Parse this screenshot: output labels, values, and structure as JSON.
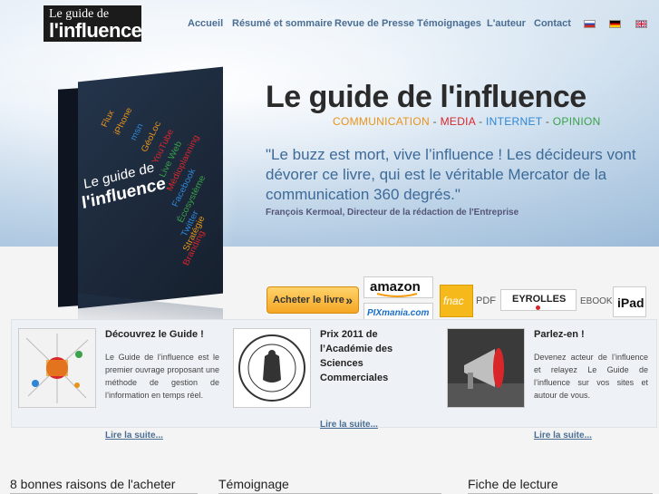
{
  "logo": {
    "line1": "Le guide de",
    "line2": "l'influence"
  },
  "nav": {
    "items": [
      "Accueil",
      "Résumé et sommaire",
      "Revue de Presse",
      "Témoignages",
      "L'auteur",
      "Contact"
    ]
  },
  "flags": [
    "ru",
    "de",
    "en"
  ],
  "book": {
    "title1": "Le guide de",
    "title2": "l'influence",
    "words": [
      "Flux",
      "iPhone",
      "msn",
      "GéoLoc",
      "YouTube",
      "Live Web",
      "Médioplanning",
      "Facebook",
      "Écosystème",
      "Twitter",
      "Stratégie",
      "Branding",
      "Tactique",
      "Open Source",
      "Sondage",
      "Rôles",
      "Leaders"
    ]
  },
  "hero": {
    "title": "Le guide de l'influence",
    "tagline": [
      {
        "text": "COMMUNICATION",
        "color": "#e8941a"
      },
      {
        "text": " - ",
        "color": "#555555"
      },
      {
        "text": "MEDIA",
        "color": "#d9262b"
      },
      {
        "text": " - ",
        "color": "#555555"
      },
      {
        "text": "INTERNET",
        "color": "#2e86d6"
      },
      {
        "text": " - ",
        "color": "#555555"
      },
      {
        "text": "OPINION",
        "color": "#3aa24a"
      }
    ],
    "quote": "\"Le buzz est mort, vive l’influence ! Les décideurs vont dévorer ce livre, qui est le véritable Mercator de la communication 360 degrés.\"",
    "quote_author": "François Kermoal, Directeur de la rédaction de l'Entreprise"
  },
  "buy": {
    "label": "Acheter le livre",
    "arrow_icon": "»"
  },
  "stores": {
    "amazon": "amazon",
    "pixmania": "PIXmania.com",
    "fnac": "fnac",
    "pdf_label": "PDF",
    "eyrolles": "EYROLLES",
    "ebook_label": "EBOOK",
    "ipad": "iPad"
  },
  "features": [
    {
      "title": "Découvrez le Guide !",
      "text": "Le Guide de l’influence est le premier ouvrage proposant une méthode de gestion de l’information en temps réel.",
      "link": "Lire la suite..."
    },
    {
      "title": "Prix 2011 de l’Académie des Sciences Commerciales",
      "text": "",
      "link": "Lire la suite...",
      "seal_text": "ACADÉMIE DES SCIENCES COMMERCIALES"
    },
    {
      "title": "Parlez-en !",
      "text": "Devenez acteur de l’influence et relayez Le Guide de l’influence sur vos sites et autour de vous.",
      "link": "Lire la suite..."
    }
  ],
  "bottom": {
    "headings": [
      "8 bonnes raisons de l'acheter",
      "Témoignage",
      "Fiche de lecture"
    ]
  }
}
